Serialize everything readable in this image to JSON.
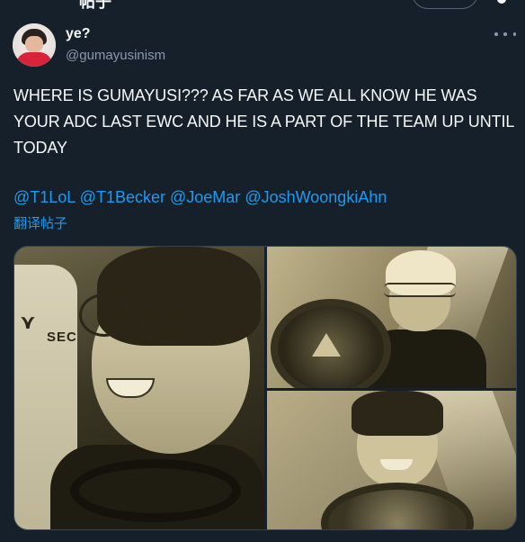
{
  "top_bar": {
    "title": "帖子"
  },
  "author": {
    "display_name": "ye?",
    "handle": "@gumayusinism"
  },
  "tweet": {
    "text": "WHERE IS GUMAYUSI??? AS FAR AS WE ALL KNOW HE WAS YOUR ADC LAST EWC AND HE IS A PART OF THE TEAM UP UNTIL TODAY",
    "mentions": [
      "@T1LoL",
      "@T1Becker",
      "@JoeMar",
      "@JoshWoongkiAhn"
    ],
    "translate_label": "翻译帖子"
  },
  "media": {
    "photo_a_text": "SEC",
    "colors": {
      "tint": "#bfb48c",
      "dark": "#2a2618"
    }
  },
  "theme": {
    "background": "#15202b",
    "text": "#f7f9f9",
    "secondary": "#8b98a5",
    "accent": "#1d9bf0"
  },
  "icons": {
    "more": "more-horizontal-icon",
    "logo": "sponsor-logo-icon"
  }
}
